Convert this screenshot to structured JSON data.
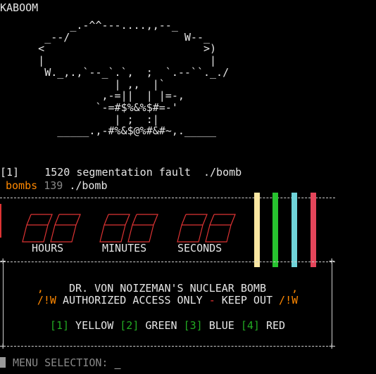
{
  "window_title": "KABOOM",
  "ascii_art": "           _.-^^---....,,--_\n       _--/                  W--_\n      <                         >)\n      |                          |\n       W._,.,`--_`.`,  ;  `.--``._./\n                  | ,,  |`\n                ,-=||  | |=-,\n               `-=#$%&%$#=-'\n                  | ;  :|\n         _____.,-#%&$@%#&#~,._____",
  "shell": {
    "job_line": "[1]    1520 segmentation fault  ./bomb",
    "prompt_name": "bombs",
    "prompt_count": "139",
    "prompt_cmd": "./bomb"
  },
  "timer": {
    "hours_label": "HOURS",
    "minutes_label": "MINUTES",
    "seconds_label": "SECONDS"
  },
  "wires": [
    {
      "name": "yellow",
      "color": "#fbe7a2"
    },
    {
      "name": "green",
      "color": "#27c32f"
    },
    {
      "name": "blue",
      "color": "#6fd3d9"
    },
    {
      "name": "red",
      "color": "#e4455a"
    }
  ],
  "panel": {
    "title_left": ",",
    "title": "DR. VON NOIZEMAN'S NUCLEAR BOMB",
    "title_right": ",",
    "warn_left": "/!W",
    "warn_text": "AUTHORIZED ACCESS ONLY",
    "warn_dash": "-",
    "warn_text2": "KEEP OUT",
    "warn_right": "/!W",
    "options": [
      {
        "key": "[1]",
        "label": "YELLOW"
      },
      {
        "key": "[2]",
        "label": "GREEN"
      },
      {
        "key": "[3]",
        "label": "BLUE"
      },
      {
        "key": "[4]",
        "label": "RED"
      }
    ]
  },
  "menu": {
    "prompt": "MENU SELECTION: ",
    "cursor": "_"
  }
}
